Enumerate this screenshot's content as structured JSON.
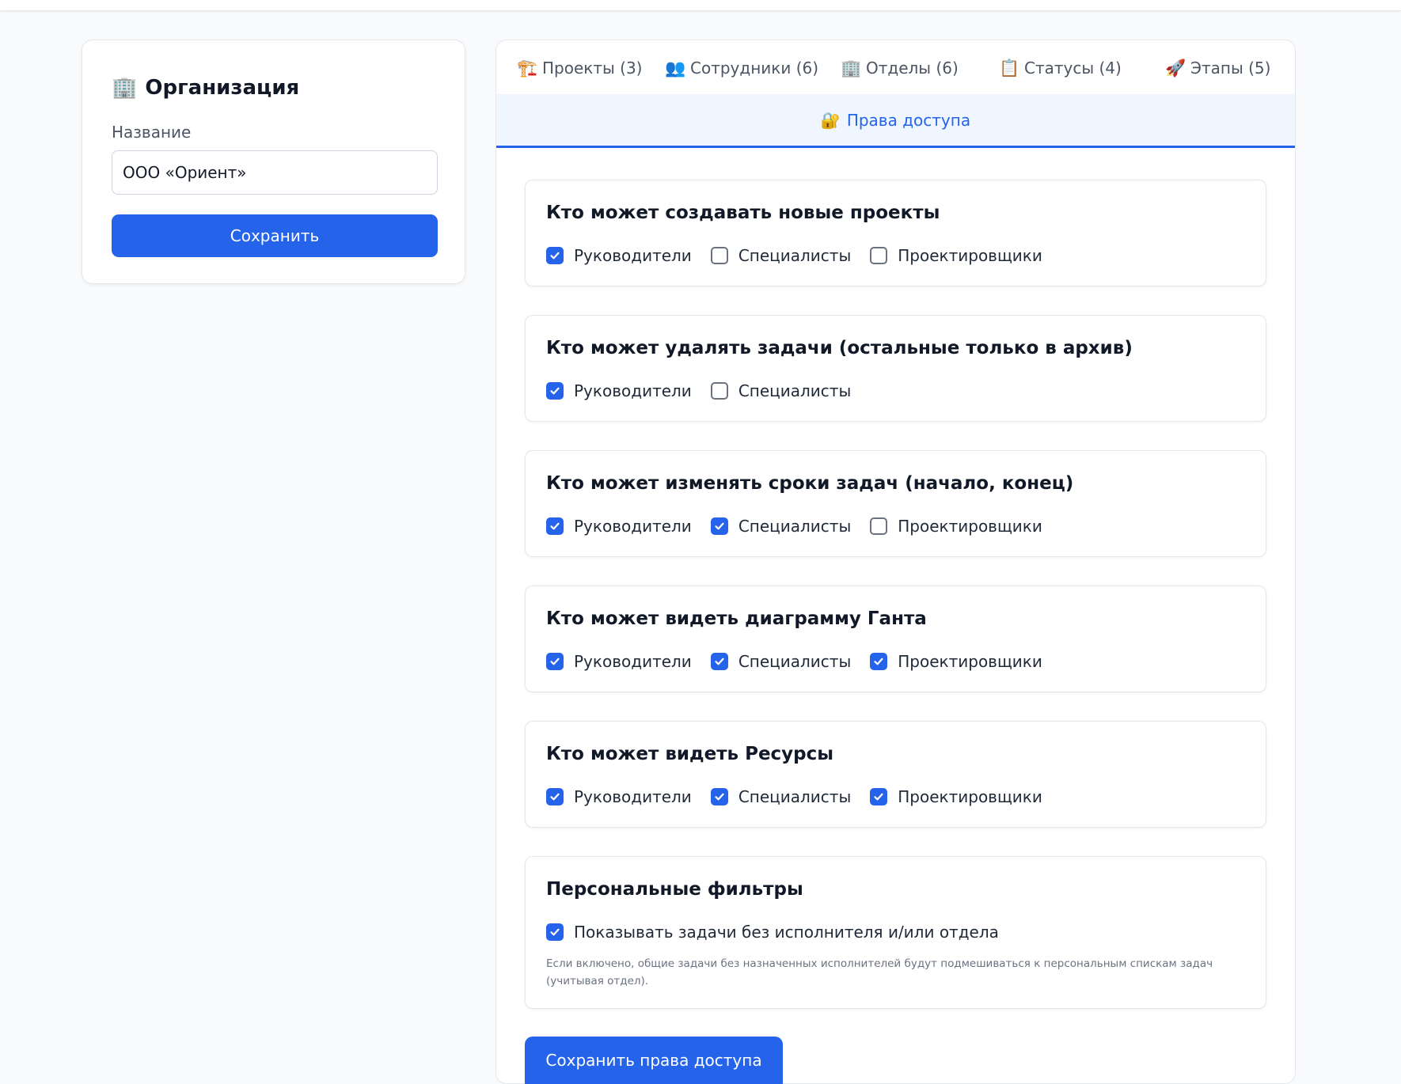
{
  "organization": {
    "icon": "🏢",
    "title": "Организация",
    "name_label": "Название",
    "name_value": "ООО «Ориент»",
    "save_label": "Сохранить"
  },
  "tabs": [
    {
      "icon": "🏗️",
      "label": "Проекты (3)"
    },
    {
      "icon": "👥",
      "label": "Сотрудники (6)"
    },
    {
      "icon": "🏢",
      "label": "Отделы (6)"
    },
    {
      "icon": "📋",
      "label": "Статусы (4)"
    },
    {
      "icon": "🚀",
      "label": "Этапы (5)"
    }
  ],
  "active_tab": {
    "icon": "🔐",
    "label": "Права доступа"
  },
  "permissions": [
    {
      "title": "Кто может создавать новые проекты",
      "options": [
        {
          "label": "Руководители",
          "checked": true
        },
        {
          "label": "Специалисты",
          "checked": false
        },
        {
          "label": "Проектировщики",
          "checked": false
        }
      ]
    },
    {
      "title": "Кто может удалять задачи (остальные только в архив)",
      "options": [
        {
          "label": "Руководители",
          "checked": true
        },
        {
          "label": "Специалисты",
          "checked": false
        }
      ]
    },
    {
      "title": "Кто может изменять сроки задач (начало, конец)",
      "options": [
        {
          "label": "Руководители",
          "checked": true
        },
        {
          "label": "Специалисты",
          "checked": true
        },
        {
          "label": "Проектировщики",
          "checked": false
        }
      ]
    },
    {
      "title": "Кто может видеть диаграмму Ганта",
      "options": [
        {
          "label": "Руководители",
          "checked": true
        },
        {
          "label": "Специалисты",
          "checked": true
        },
        {
          "label": "Проектировщики",
          "checked": true
        }
      ]
    },
    {
      "title": "Кто может видеть Ресурсы",
      "options": [
        {
          "label": "Руководители",
          "checked": true
        },
        {
          "label": "Специалисты",
          "checked": true
        },
        {
          "label": "Проектировщики",
          "checked": true
        }
      ]
    }
  ],
  "personal_filters": {
    "title": "Персональные фильтры",
    "option": {
      "label": "Показывать задачи без исполнителя и/или отдела",
      "checked": true
    },
    "hint": "Если включено, общие задачи без назначенных исполнителей будут подмешиваться к персональным спискам задач (учитывая отдел)."
  },
  "save_access_label": "Сохранить права доступа",
  "colors": {
    "accent": "#2563eb",
    "active_tab_bg": "#eff6ff"
  }
}
